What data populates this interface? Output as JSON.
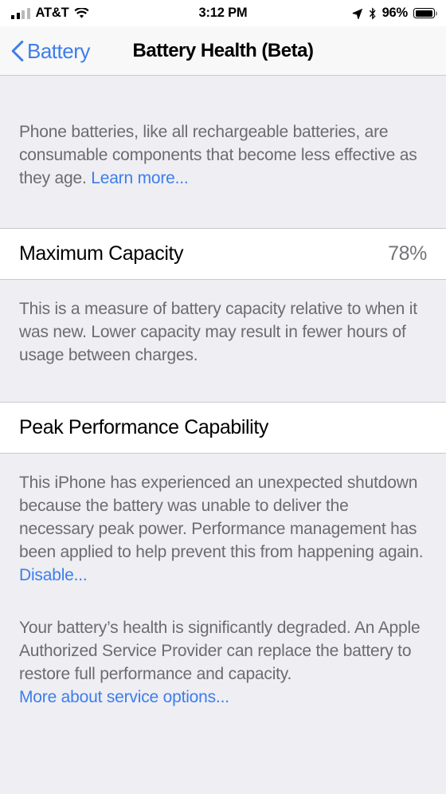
{
  "status_bar": {
    "carrier": "AT&T",
    "time": "3:12 PM",
    "battery_percent": "96%",
    "signal_bars_filled": 2,
    "signal_bars_total": 4,
    "wifi_icon": "wifi-icon",
    "location_icon": "location-arrow-icon",
    "bluetooth_icon": "bluetooth-icon",
    "battery_icon": "battery-icon"
  },
  "nav": {
    "back_label": "Battery",
    "back_icon": "chevron-left-icon",
    "title": "Battery Health (Beta)"
  },
  "intro": {
    "text": "Phone batteries, like all rechargeable batteries, are consumable components that become less effective as they age. ",
    "link": "Learn more..."
  },
  "maximum_capacity": {
    "label": "Maximum Capacity",
    "value": "78%",
    "note": "This is a measure of battery capacity relative to when it was new. Lower capacity may result in fewer hours of usage between charges."
  },
  "peak_performance": {
    "label": "Peak Performance Capability",
    "note": "This iPhone has experienced an unexpected shutdown because the battery was unable to deliver the necessary peak power. Performance management has been applied to help prevent this from happening again. ",
    "disable_link": "Disable...",
    "service_note": "Your battery’s health is significantly degraded. An Apple Authorized Service Provider can replace the battery to restore full performance and capacity.",
    "service_link": "More about service options..."
  },
  "colors": {
    "accent_blue": "#3d7eeb",
    "group_background": "#eeeef3",
    "cell_background": "#ffffff",
    "secondary_text": "#6c6c70"
  }
}
